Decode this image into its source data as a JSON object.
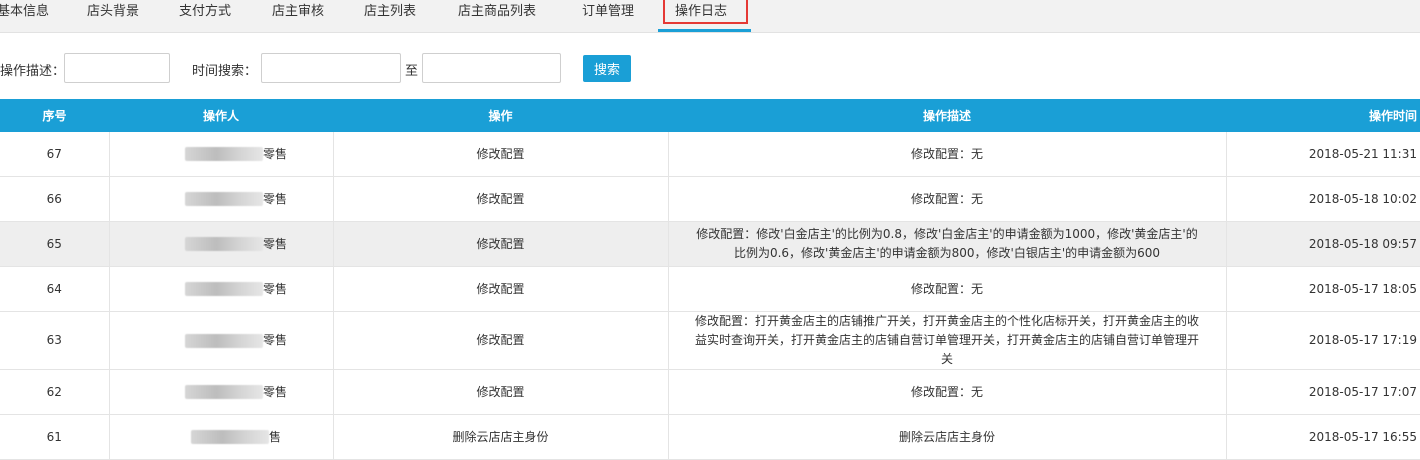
{
  "tabs": [
    {
      "label": "基本信息"
    },
    {
      "label": "店头背景"
    },
    {
      "label": "支付方式"
    },
    {
      "label": "店主审核"
    },
    {
      "label": "店主列表"
    },
    {
      "label": "店主商品列表"
    },
    {
      "label": "订单管理"
    },
    {
      "label": "操作日志"
    }
  ],
  "active_tab": "操作日志",
  "filters": {
    "desc_label": "操作描述：",
    "desc_value": "",
    "time_label": "时间搜索：",
    "time_start": "",
    "range_sep": "至",
    "time_end": "",
    "search_label": "搜索"
  },
  "table": {
    "headers": [
      "序号",
      "操作人",
      "操作",
      "操作描述",
      "操作时间"
    ],
    "rows": [
      {
        "id": "67",
        "operator": "零售",
        "action": "修改配置",
        "desc": "修改配置：无",
        "time": "2018-05-21 11:31"
      },
      {
        "id": "66",
        "operator": "零售",
        "action": "修改配置",
        "desc": "修改配置：无",
        "time": "2018-05-18 10:02"
      },
      {
        "id": "65",
        "operator": "零售",
        "action": "修改配置",
        "desc": "修改配置：修改'白金店主'的比例为0.8，修改'白金店主'的申请金额为1000，修改'黄金店主'的比例为0.6，修改'黄金店主'的申请金额为800，修改'白银店主'的申请金额为600",
        "time": "2018-05-18 09:57"
      },
      {
        "id": "64",
        "operator": "零售",
        "action": "修改配置",
        "desc": "修改配置：无",
        "time": "2018-05-17 18:05"
      },
      {
        "id": "63",
        "operator": "零售",
        "action": "修改配置",
        "desc": "修改配置：打开黄金店主的店铺推广开关，打开黄金店主的个性化店标开关，打开黄金店主的收益实时查询开关，打开黄金店主的店铺自营订单管理开关，打开黄金店主的店铺自营订单管理开关",
        "time": "2018-05-17 17:19"
      },
      {
        "id": "62",
        "operator": "零售",
        "action": "修改配置",
        "desc": "修改配置：无",
        "time": "2018-05-17 17:07"
      },
      {
        "id": "61",
        "operator": "售",
        "action": "删除云店店主身份",
        "desc": "删除云店店主身份",
        "time": "2018-05-17 16:55"
      }
    ]
  },
  "colors": {
    "accent": "#1a9fd6",
    "highlight_border": "#e53935"
  }
}
